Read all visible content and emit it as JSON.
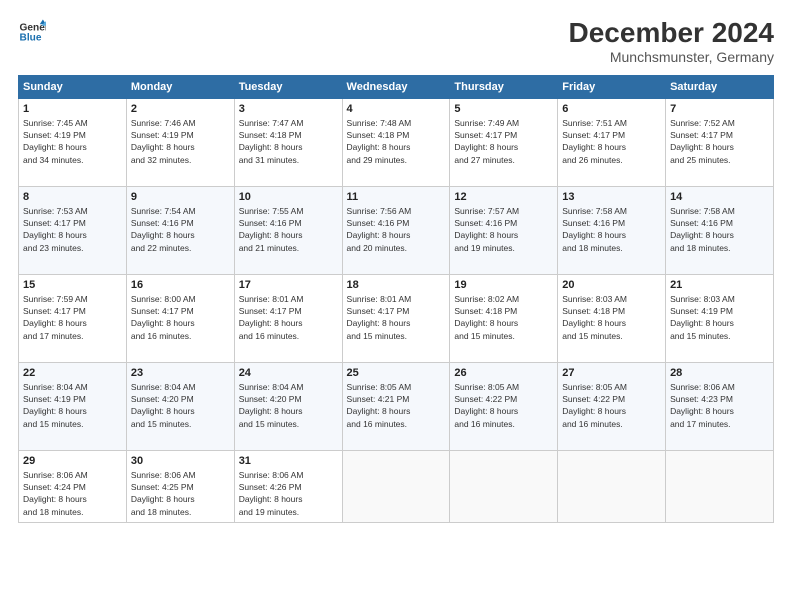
{
  "header": {
    "logo_line1": "General",
    "logo_line2": "Blue",
    "month": "December 2024",
    "location": "Munchsmunster, Germany"
  },
  "weekdays": [
    "Sunday",
    "Monday",
    "Tuesday",
    "Wednesday",
    "Thursday",
    "Friday",
    "Saturday"
  ],
  "weeks": [
    [
      {
        "day": "1",
        "lines": [
          "Sunrise: 7:45 AM",
          "Sunset: 4:19 PM",
          "Daylight: 8 hours",
          "and 34 minutes."
        ]
      },
      {
        "day": "2",
        "lines": [
          "Sunrise: 7:46 AM",
          "Sunset: 4:19 PM",
          "Daylight: 8 hours",
          "and 32 minutes."
        ]
      },
      {
        "day": "3",
        "lines": [
          "Sunrise: 7:47 AM",
          "Sunset: 4:18 PM",
          "Daylight: 8 hours",
          "and 31 minutes."
        ]
      },
      {
        "day": "4",
        "lines": [
          "Sunrise: 7:48 AM",
          "Sunset: 4:18 PM",
          "Daylight: 8 hours",
          "and 29 minutes."
        ]
      },
      {
        "day": "5",
        "lines": [
          "Sunrise: 7:49 AM",
          "Sunset: 4:17 PM",
          "Daylight: 8 hours",
          "and 27 minutes."
        ]
      },
      {
        "day": "6",
        "lines": [
          "Sunrise: 7:51 AM",
          "Sunset: 4:17 PM",
          "Daylight: 8 hours",
          "and 26 minutes."
        ]
      },
      {
        "day": "7",
        "lines": [
          "Sunrise: 7:52 AM",
          "Sunset: 4:17 PM",
          "Daylight: 8 hours",
          "and 25 minutes."
        ]
      }
    ],
    [
      {
        "day": "8",
        "lines": [
          "Sunrise: 7:53 AM",
          "Sunset: 4:17 PM",
          "Daylight: 8 hours",
          "and 23 minutes."
        ]
      },
      {
        "day": "9",
        "lines": [
          "Sunrise: 7:54 AM",
          "Sunset: 4:16 PM",
          "Daylight: 8 hours",
          "and 22 minutes."
        ]
      },
      {
        "day": "10",
        "lines": [
          "Sunrise: 7:55 AM",
          "Sunset: 4:16 PM",
          "Daylight: 8 hours",
          "and 21 minutes."
        ]
      },
      {
        "day": "11",
        "lines": [
          "Sunrise: 7:56 AM",
          "Sunset: 4:16 PM",
          "Daylight: 8 hours",
          "and 20 minutes."
        ]
      },
      {
        "day": "12",
        "lines": [
          "Sunrise: 7:57 AM",
          "Sunset: 4:16 PM",
          "Daylight: 8 hours",
          "and 19 minutes."
        ]
      },
      {
        "day": "13",
        "lines": [
          "Sunrise: 7:58 AM",
          "Sunset: 4:16 PM",
          "Daylight: 8 hours",
          "and 18 minutes."
        ]
      },
      {
        "day": "14",
        "lines": [
          "Sunrise: 7:58 AM",
          "Sunset: 4:16 PM",
          "Daylight: 8 hours",
          "and 18 minutes."
        ]
      }
    ],
    [
      {
        "day": "15",
        "lines": [
          "Sunrise: 7:59 AM",
          "Sunset: 4:17 PM",
          "Daylight: 8 hours",
          "and 17 minutes."
        ]
      },
      {
        "day": "16",
        "lines": [
          "Sunrise: 8:00 AM",
          "Sunset: 4:17 PM",
          "Daylight: 8 hours",
          "and 16 minutes."
        ]
      },
      {
        "day": "17",
        "lines": [
          "Sunrise: 8:01 AM",
          "Sunset: 4:17 PM",
          "Daylight: 8 hours",
          "and 16 minutes."
        ]
      },
      {
        "day": "18",
        "lines": [
          "Sunrise: 8:01 AM",
          "Sunset: 4:17 PM",
          "Daylight: 8 hours",
          "and 15 minutes."
        ]
      },
      {
        "day": "19",
        "lines": [
          "Sunrise: 8:02 AM",
          "Sunset: 4:18 PM",
          "Daylight: 8 hours",
          "and 15 minutes."
        ]
      },
      {
        "day": "20",
        "lines": [
          "Sunrise: 8:03 AM",
          "Sunset: 4:18 PM",
          "Daylight: 8 hours",
          "and 15 minutes."
        ]
      },
      {
        "day": "21",
        "lines": [
          "Sunrise: 8:03 AM",
          "Sunset: 4:19 PM",
          "Daylight: 8 hours",
          "and 15 minutes."
        ]
      }
    ],
    [
      {
        "day": "22",
        "lines": [
          "Sunrise: 8:04 AM",
          "Sunset: 4:19 PM",
          "Daylight: 8 hours",
          "and 15 minutes."
        ]
      },
      {
        "day": "23",
        "lines": [
          "Sunrise: 8:04 AM",
          "Sunset: 4:20 PM",
          "Daylight: 8 hours",
          "and 15 minutes."
        ]
      },
      {
        "day": "24",
        "lines": [
          "Sunrise: 8:04 AM",
          "Sunset: 4:20 PM",
          "Daylight: 8 hours",
          "and 15 minutes."
        ]
      },
      {
        "day": "25",
        "lines": [
          "Sunrise: 8:05 AM",
          "Sunset: 4:21 PM",
          "Daylight: 8 hours",
          "and 16 minutes."
        ]
      },
      {
        "day": "26",
        "lines": [
          "Sunrise: 8:05 AM",
          "Sunset: 4:22 PM",
          "Daylight: 8 hours",
          "and 16 minutes."
        ]
      },
      {
        "day": "27",
        "lines": [
          "Sunrise: 8:05 AM",
          "Sunset: 4:22 PM",
          "Daylight: 8 hours",
          "and 16 minutes."
        ]
      },
      {
        "day": "28",
        "lines": [
          "Sunrise: 8:06 AM",
          "Sunset: 4:23 PM",
          "Daylight: 8 hours",
          "and 17 minutes."
        ]
      }
    ],
    [
      {
        "day": "29",
        "lines": [
          "Sunrise: 8:06 AM",
          "Sunset: 4:24 PM",
          "Daylight: 8 hours",
          "and 18 minutes."
        ]
      },
      {
        "day": "30",
        "lines": [
          "Sunrise: 8:06 AM",
          "Sunset: 4:25 PM",
          "Daylight: 8 hours",
          "and 18 minutes."
        ]
      },
      {
        "day": "31",
        "lines": [
          "Sunrise: 8:06 AM",
          "Sunset: 4:26 PM",
          "Daylight: 8 hours",
          "and 19 minutes."
        ]
      },
      {
        "day": "",
        "lines": []
      },
      {
        "day": "",
        "lines": []
      },
      {
        "day": "",
        "lines": []
      },
      {
        "day": "",
        "lines": []
      }
    ]
  ]
}
